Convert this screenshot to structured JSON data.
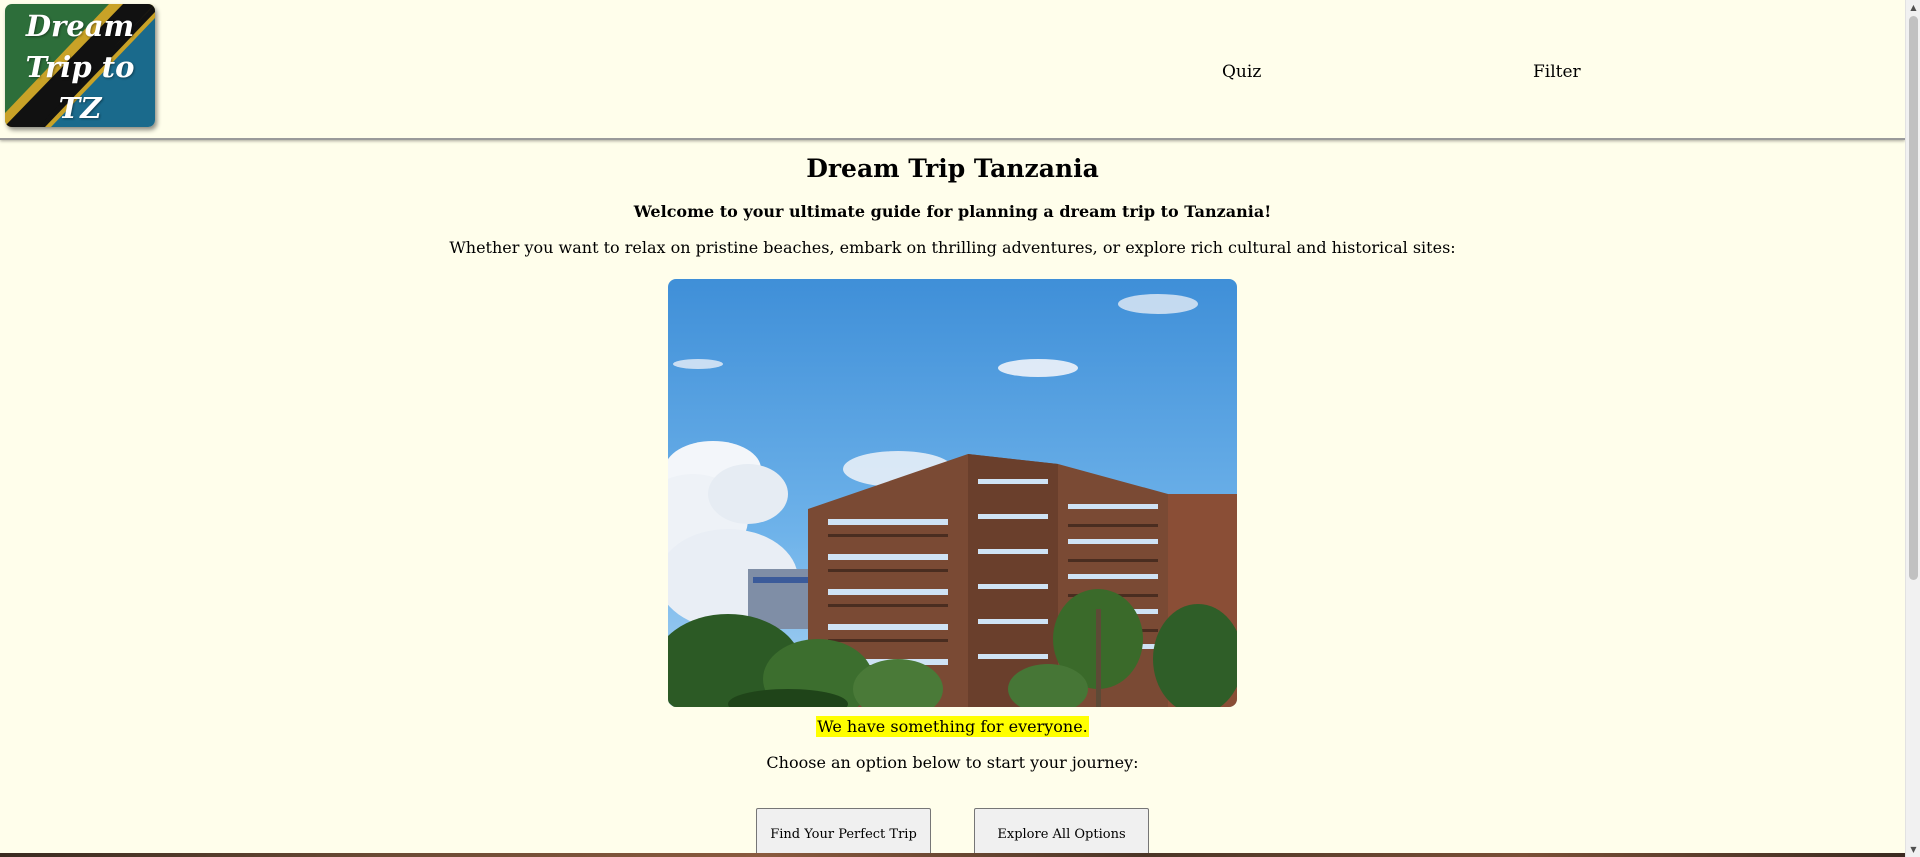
{
  "header": {
    "logo_text": "Dream Trip to TZ",
    "nav": {
      "quiz": "Quiz",
      "filter": "Filter"
    }
  },
  "main": {
    "title": "Dream Trip Tanzania",
    "welcome": "Welcome to your ultimate guide for planning a dream trip to Tanzania!",
    "description": "Whether you want to relax on pristine beaches, embark on thrilling adventures, or explore rich cultural and historical sites:",
    "highlight": "We have something for everyone.",
    "choose": "Choose an option below to start your journey:",
    "buttons": {
      "find": "Find Your Perfect Trip",
      "explore": "Explore All Options"
    }
  },
  "colors": {
    "background": "#fffeeb",
    "highlight": "#ffff00",
    "flag_green": "#1eb53a",
    "flag_yellow": "#fcd116",
    "flag_black": "#000000",
    "flag_blue": "#00a3dd"
  }
}
